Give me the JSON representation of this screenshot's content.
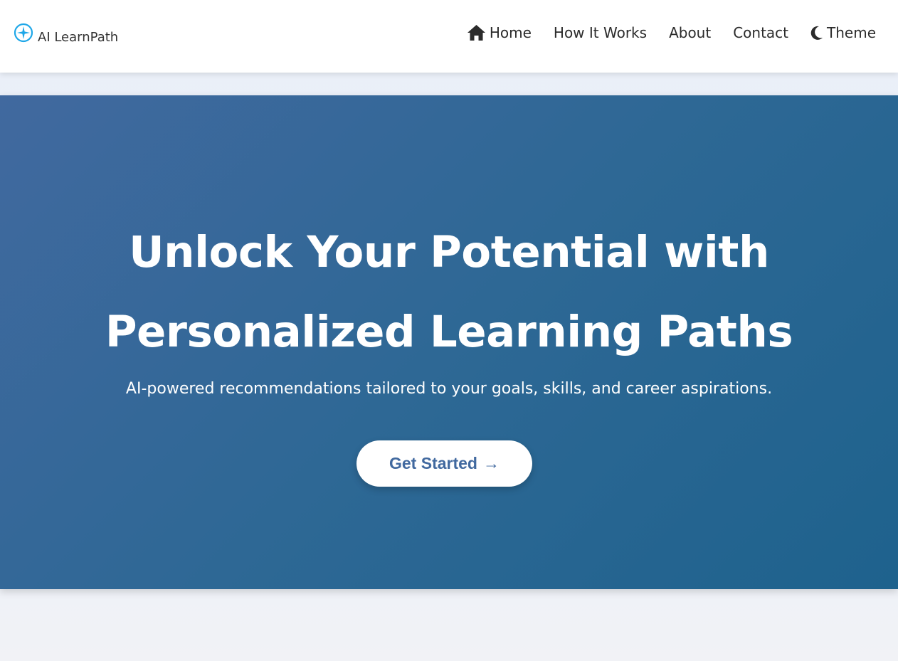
{
  "brand": {
    "name": "AI LearnPath",
    "icon": "compass-icon",
    "icon_color": "#1ea7e8"
  },
  "nav": {
    "home": {
      "label": "Home",
      "icon": "home-icon"
    },
    "how_it_works": {
      "label": "How It Works"
    },
    "about": {
      "label": "About"
    },
    "contact": {
      "label": "Contact"
    },
    "theme": {
      "label": "Theme",
      "icon": "moon-icon"
    }
  },
  "hero": {
    "title_line1": "Unlock Your Potential with",
    "title_line2": "Personalized Learning Paths",
    "subtitle": "AI-powered recommendations tailored to your goals, skills, and career aspirations.",
    "cta_label": "Get Started",
    "cta_arrow": "→"
  },
  "colors": {
    "hero_gradient_start": "#41699f",
    "hero_gradient_end": "#1e628d",
    "cta_text": "#41699f",
    "nav_text": "#2b2b2b"
  }
}
